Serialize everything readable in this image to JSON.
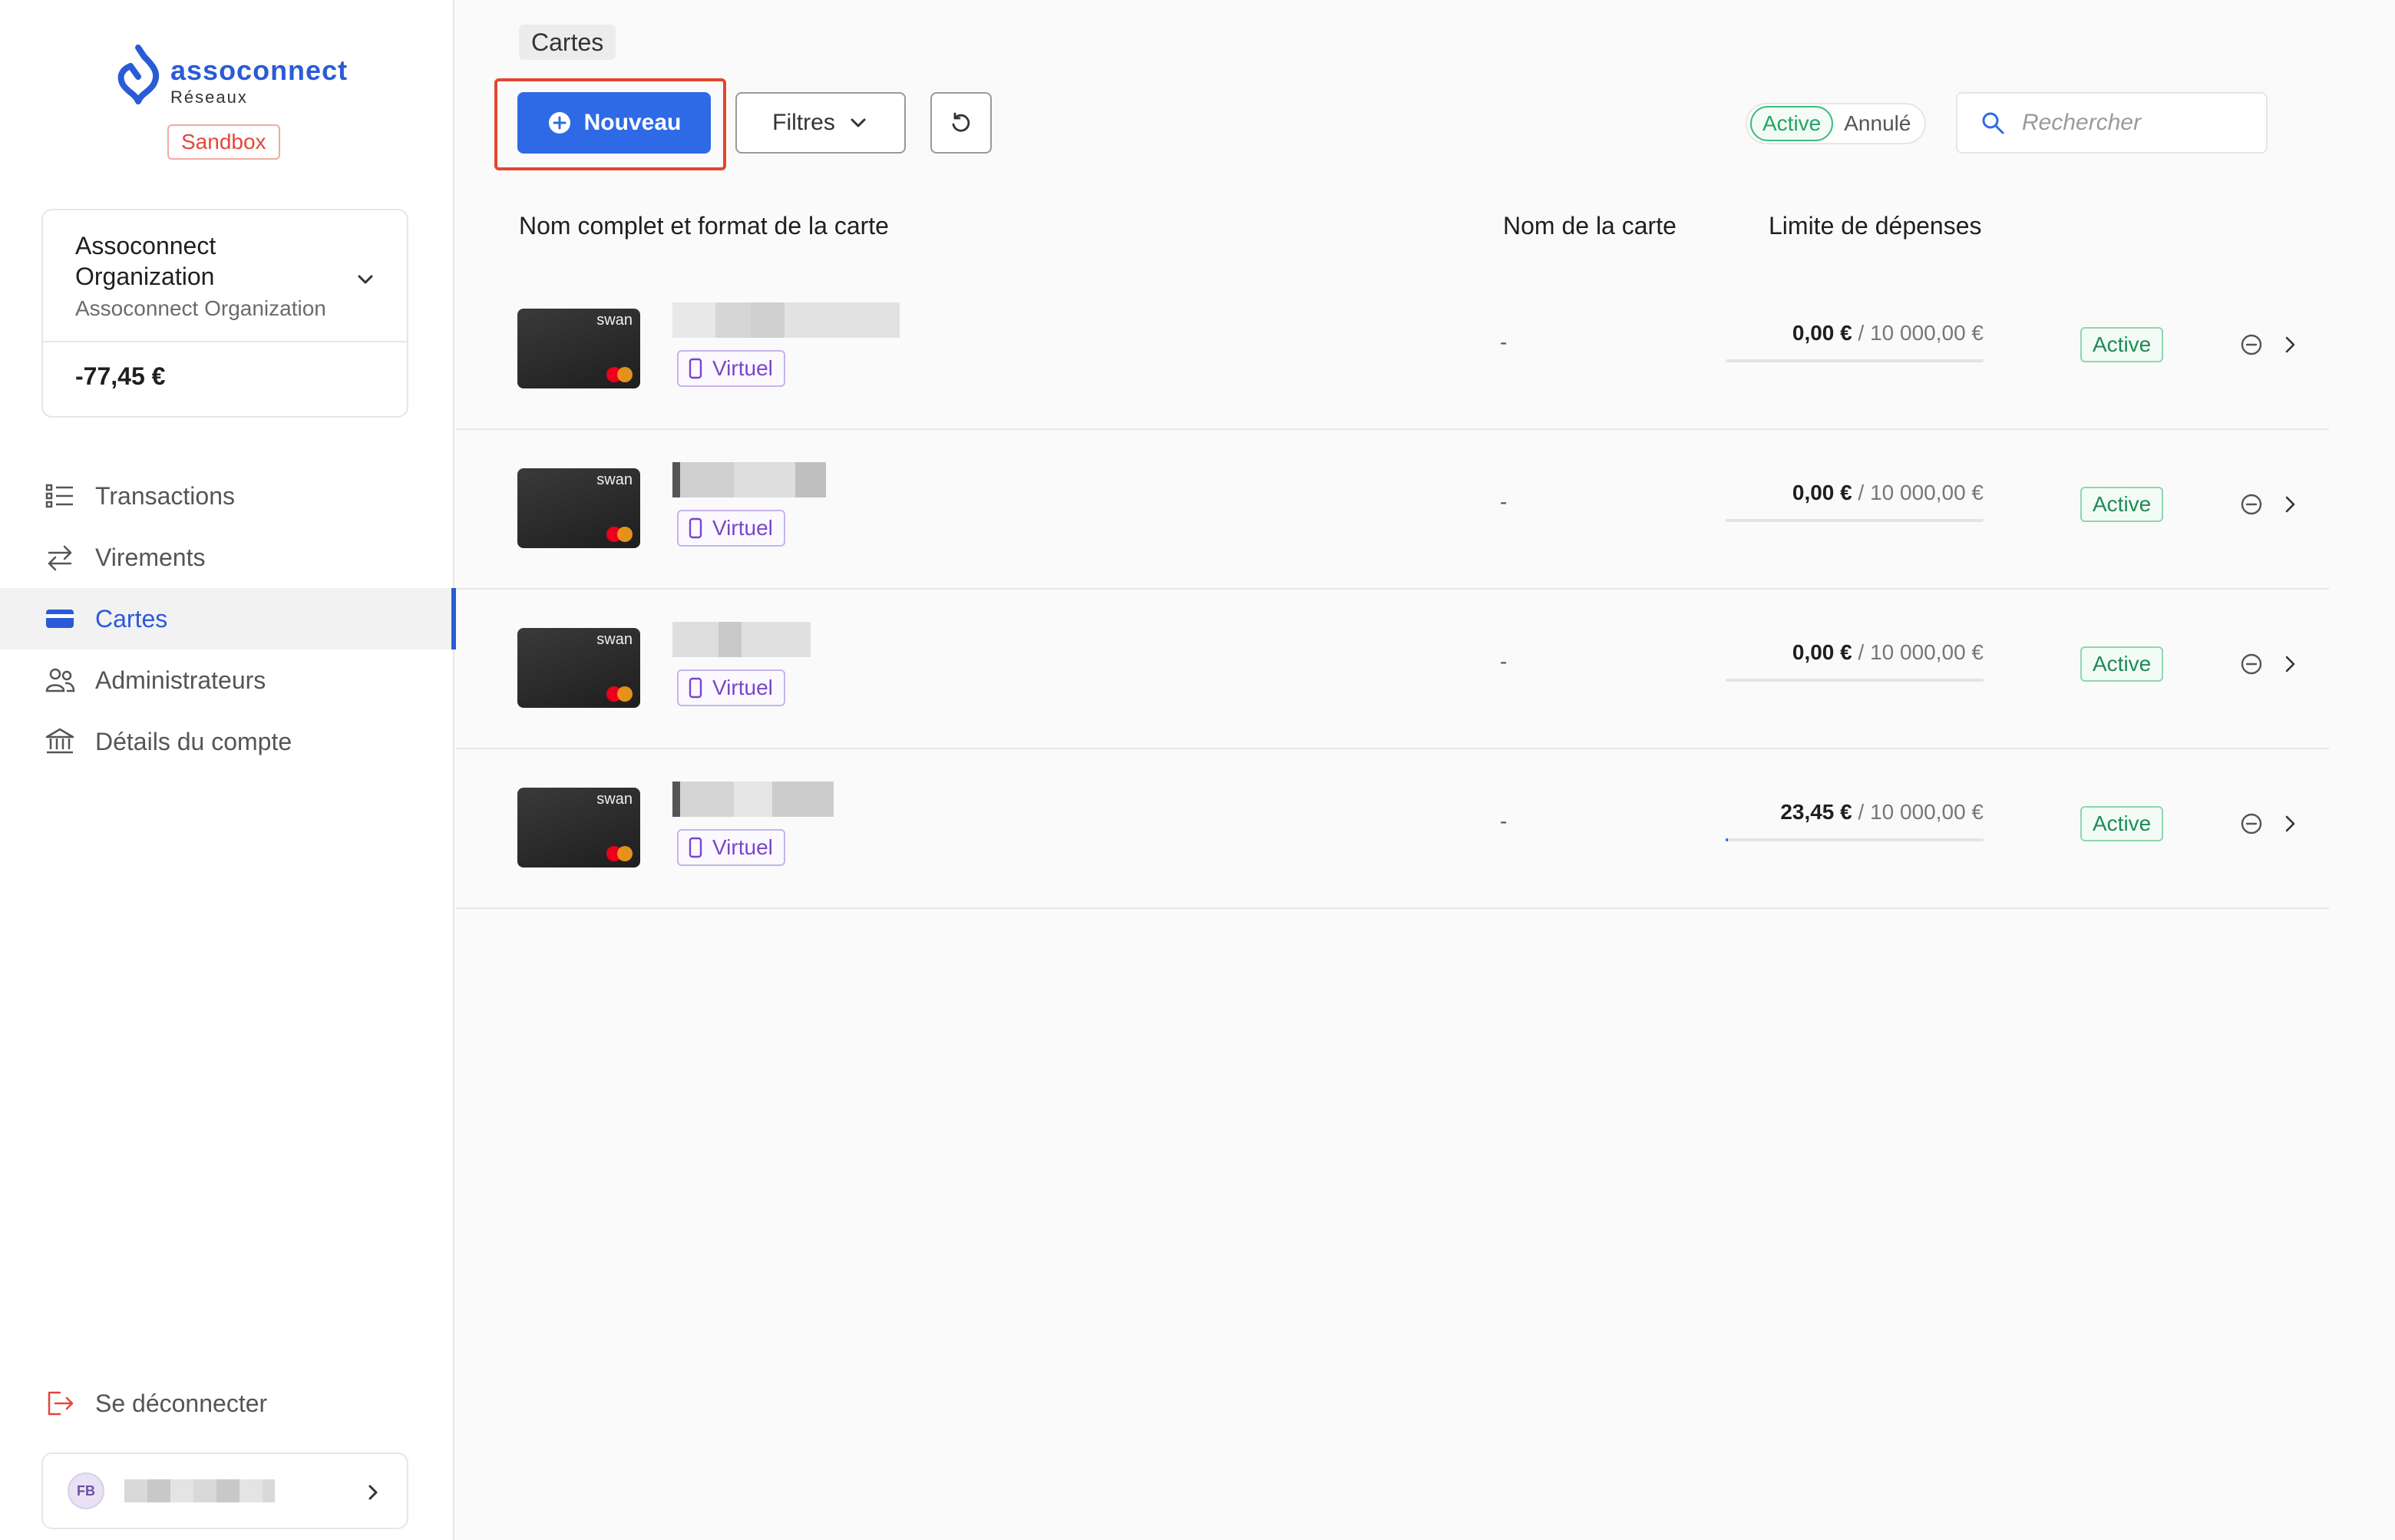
{
  "brand": {
    "name": "assoconnect",
    "subtitle": "Réseaux",
    "env_badge": "Sandbox",
    "color": "#2a5bd7"
  },
  "organization": {
    "name": "Assoconnect Organization",
    "subtitle": "Assoconnect Organization",
    "balance": "-77,45 €"
  },
  "nav": {
    "items": [
      {
        "label": "Transactions",
        "icon": "list-icon",
        "active": false
      },
      {
        "label": "Virements",
        "icon": "transfer-arrows-icon",
        "active": false
      },
      {
        "label": "Cartes",
        "icon": "credit-card-icon",
        "active": true
      },
      {
        "label": "Administrateurs",
        "icon": "users-icon",
        "active": false
      },
      {
        "label": "Détails du compte",
        "icon": "bank-icon",
        "active": false
      }
    ],
    "logout_label": "Se déconnecter"
  },
  "user": {
    "initials": "FB"
  },
  "page": {
    "title": "Cartes"
  },
  "toolbar": {
    "new_label": "Nouveau",
    "filter_label": "Filtres",
    "status_active": "Active",
    "status_cancelled": "Annulé",
    "search_placeholder": "Rechercher",
    "accent": "#2f6ae6"
  },
  "table": {
    "headers": {
      "holder": "Nom complet et format de la carte",
      "card_name": "Nom de la carte",
      "limit": "Limite de dépenses"
    },
    "rows": [
      {
        "card_brand": "swan",
        "format": "Virtuel",
        "card_name": "-",
        "spent": "0,00 €",
        "limit": "10 000,00 €",
        "spent_ratio": 0.0,
        "status": "Active"
      },
      {
        "card_brand": "swan",
        "format": "Virtuel",
        "card_name": "-",
        "spent": "0,00 €",
        "limit": "10 000,00 €",
        "spent_ratio": 0.0,
        "status": "Active"
      },
      {
        "card_brand": "swan",
        "format": "Virtuel",
        "card_name": "-",
        "spent": "0,00 €",
        "limit": "10 000,00 €",
        "spent_ratio": 0.0,
        "status": "Active"
      },
      {
        "card_brand": "swan",
        "format": "Virtuel",
        "card_name": "-",
        "spent": "23,45 €",
        "limit": "10 000,00 €",
        "spent_ratio": 0.0023,
        "status": "Active"
      }
    ]
  }
}
